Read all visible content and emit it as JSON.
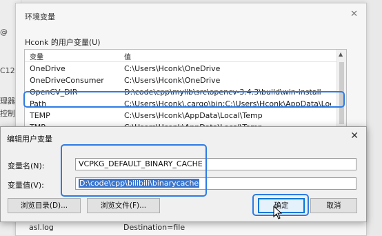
{
  "background_window": {
    "fragments": [
      "@",
      "C12",
      "理器",
      "控制"
    ]
  },
  "env_dialog": {
    "title": "环境变量",
    "user_vars_label": "Hconk 的用户变量(U)",
    "table": {
      "headers": [
        "变量",
        "值"
      ],
      "rows": [
        {
          "name": "OneDrive",
          "value": "C:\\Users\\Hconk\\OneDrive"
        },
        {
          "name": "OneDriveConsumer",
          "value": "C:\\Users\\Hconk\\OneDrive"
        },
        {
          "name": "OpenCV_DIR",
          "value": "D:\\code\\cpp\\mylib\\src\\opencv-3.4.3\\build\\win-install"
        },
        {
          "name": "Path",
          "value": "C:\\Users\\Hconk\\.cargo\\bin;C:\\Users\\Hconk\\AppData\\Local\\Mic..."
        },
        {
          "name": "TEMP",
          "value": "C:\\Users\\Hconk\\AppData\\Local\\Temp"
        },
        {
          "name": "TMP",
          "value": "C:\\Users\\Hconk\\AppData\\Local\\Temp"
        }
      ]
    },
    "lower_list": [
      {
        "name": "asl.log",
        "value": "Destination=file"
      }
    ]
  },
  "edit_dialog": {
    "title": "编辑用户变量",
    "name_label": "变量名(N):",
    "name_value": "VCPKG_DEFAULT_BINARY_CACHE",
    "value_label": "变量值(V):",
    "value_value": "D:\\code\\cpp\\bilibili\\binarycache",
    "buttons": {
      "browse_dir": "浏览目录(D)...",
      "browse_file": "浏览文件(F)...",
      "ok": "确定",
      "cancel": "取消"
    }
  },
  "colors": {
    "highlight": "#2c7be5",
    "selection": "#3b75cc"
  }
}
